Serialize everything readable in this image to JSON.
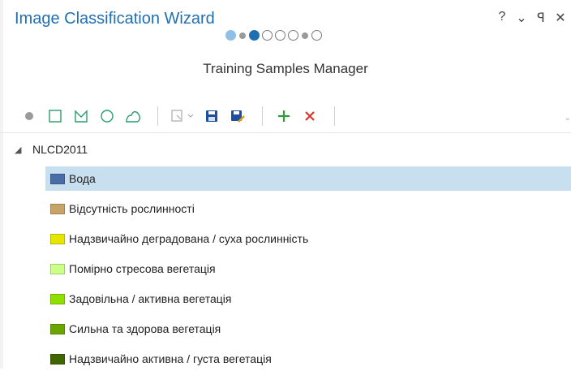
{
  "window": {
    "title": "Image Classification Wizard",
    "controls": {
      "help": "?",
      "menu": "⌄",
      "pin": "ꟼ",
      "close": "✕"
    }
  },
  "wizard": {
    "steps": [
      "done-lg",
      "done-sm",
      "active-lg",
      "empty-lg",
      "empty-lg",
      "empty-lg",
      "done-sm",
      "empty-lg"
    ],
    "page_title": "Training Samples Manager"
  },
  "toolbar": {
    "tools": [
      "point-icon",
      "rectangle-icon",
      "polygon-icon",
      "circle-icon",
      "freehand-icon",
      "import-icon",
      "save-icon",
      "save-as-icon",
      "add-icon",
      "delete-icon"
    ],
    "accent_add": "#2e9e3a",
    "accent_delete": "#d9342b",
    "accent_save": "#1f4f9c"
  },
  "tree": {
    "root_label": "NLCD2011",
    "classes": [
      {
        "label": "Вода",
        "color": "#4a6da7",
        "selected": true
      },
      {
        "label": "Відсутність рослинності",
        "color": "#c9a46a",
        "selected": false
      },
      {
        "label": "Надзвичайно деградована / суха рослинність",
        "color": "#e6e600",
        "selected": false
      },
      {
        "label": "Помірно стресова вегетація",
        "color": "#ccff88",
        "selected": false
      },
      {
        "label": "Задовільна / активна вегетація",
        "color": "#8fe000",
        "selected": false
      },
      {
        "label": "Сильна та здорова вегетація",
        "color": "#6aa600",
        "selected": false
      },
      {
        "label": "Надзвичайно активна / густа вегетація",
        "color": "#3f6600",
        "selected": false
      }
    ]
  }
}
